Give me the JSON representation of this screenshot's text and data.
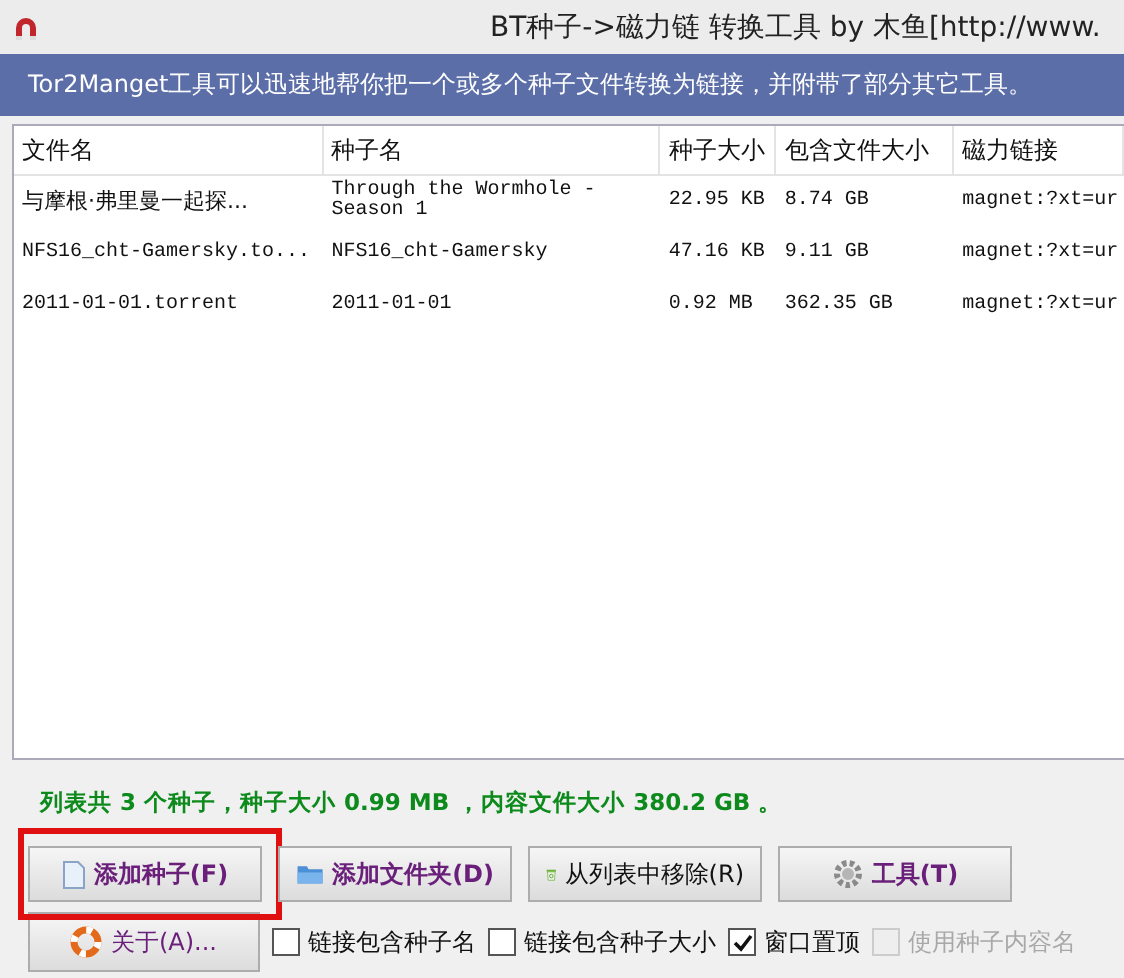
{
  "window": {
    "title": "BT种子->磁力链 转换工具 by 木鱼[http://www."
  },
  "banner": "Tor2Manget工具可以迅速地帮你把一个或多个种子文件转换为链接，并附带了部分其它工具。",
  "table": {
    "columns": [
      "文件名",
      "种子名",
      "种子大小",
      "包含文件大小",
      "磁力链接"
    ],
    "rows": [
      [
        "与摩根·弗里曼一起探...",
        "Through the Wormhole - Season 1",
        "22.95 KB",
        "8.74 GB",
        "magnet:?xt=ur"
      ],
      [
        "NFS16_cht-Gamersky.to...",
        "NFS16_cht-Gamersky",
        "47.16 KB",
        "9.11 GB",
        "magnet:?xt=ur"
      ],
      [
        "2011-01-01.torrent",
        "2011-01-01",
        "0.92 MB",
        "362.35 GB",
        "magnet:?xt=ur"
      ]
    ]
  },
  "summary": "列表共 3 个种子，种子大小 0.99 MB ，内容文件大小 380.2 GB 。",
  "buttons": [
    {
      "label": "添加种子(F)",
      "kind": "file",
      "emphasis": true,
      "highlighted": true
    },
    {
      "label": "添加文件夹(D)",
      "kind": "folder",
      "emphasis": true,
      "highlighted": false
    },
    {
      "label": "从列表中移除(R)",
      "kind": "recycle",
      "emphasis": false,
      "highlighted": false
    },
    {
      "label": "工具(T)",
      "kind": "gear",
      "emphasis": true,
      "highlighted": false
    }
  ],
  "about_button": {
    "label": "关于(A)..."
  },
  "options": [
    {
      "label": "链接包含种子名",
      "checked": false,
      "disabled": false
    },
    {
      "label": "链接包含种子大小",
      "checked": false,
      "disabled": false
    },
    {
      "label": "窗口置顶",
      "checked": true,
      "disabled": false
    },
    {
      "label": "使用种子内容名",
      "checked": false,
      "disabled": true
    }
  ]
}
